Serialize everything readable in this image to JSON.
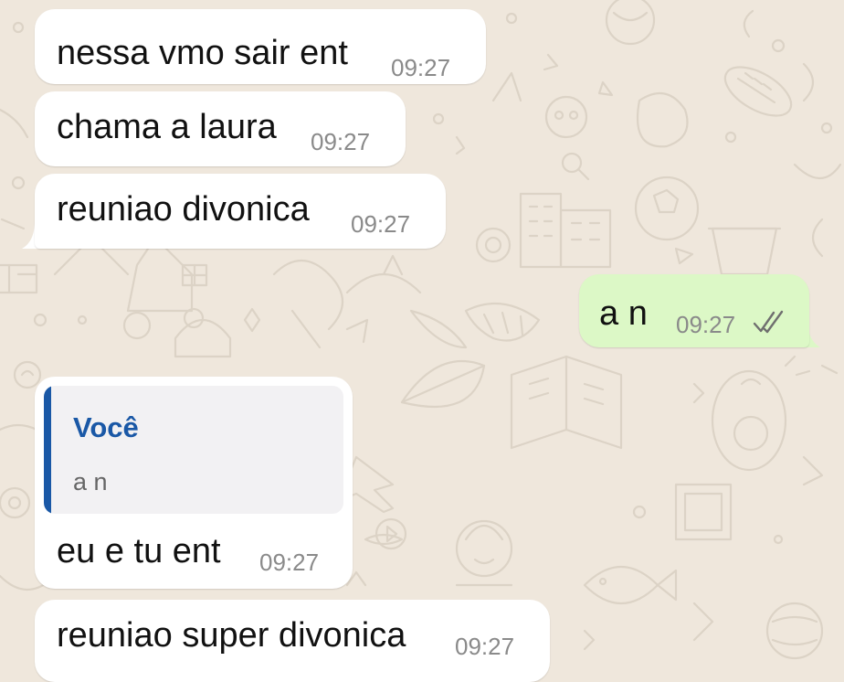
{
  "conversation": {
    "messages": [
      {
        "direction": "incoming",
        "text": "nessa vmo sair ent",
        "time": "09:27"
      },
      {
        "direction": "incoming",
        "text": "chama a laura",
        "time": "09:27"
      },
      {
        "direction": "incoming",
        "text": "reuniao divonica",
        "time": "09:27"
      },
      {
        "direction": "outgoing",
        "text": "a n",
        "time": "09:27",
        "status_icon": "double-check-icon"
      },
      {
        "direction": "incoming",
        "reply_to": {
          "author": "Você",
          "text": "a n"
        },
        "text": "eu e tu ent",
        "time": "09:27"
      },
      {
        "direction": "incoming",
        "text": "reuniao super divonica",
        "time": "09:27"
      }
    ]
  },
  "colors": {
    "background": "#efe7dc",
    "incoming_bubble": "#ffffff",
    "outgoing_bubble": "#dcf8c6",
    "quote_accent": "#1a58a6",
    "read_ticks": "#6f6f6f"
  },
  "wallpaper": "doodle-pattern"
}
